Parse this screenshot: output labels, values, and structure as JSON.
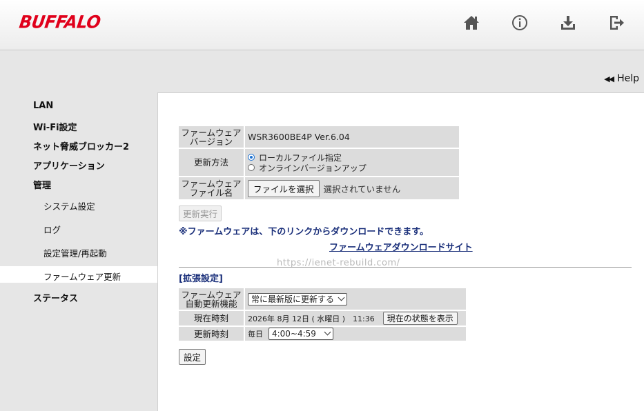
{
  "header": {
    "logo": "BUFFALO",
    "icons": [
      "home-icon",
      "info-icon",
      "download-icon",
      "logout-icon"
    ]
  },
  "help": {
    "label": "Help"
  },
  "sidebar": {
    "items": [
      {
        "label": "LAN"
      },
      {
        "label": "Wi-Fi設定"
      },
      {
        "label": "ネット脅威ブロッカー2"
      },
      {
        "label": "アプリケーション"
      },
      {
        "label": "管理"
      }
    ],
    "subitems": [
      {
        "label": "システム設定"
      },
      {
        "label": "ログ"
      },
      {
        "label": "設定管理/再起動"
      },
      {
        "label": "ファームウェア更新"
      }
    ],
    "status": "ステータス"
  },
  "firmware": {
    "version_label_1": "ファームウェア",
    "version_label_2": "バージョン",
    "version_value": "WSR3600BE4P Ver.6.04",
    "method_label": "更新方法",
    "method_options": [
      "ローカルファイル指定",
      "オンラインバージョンアップ"
    ],
    "file_label_1": "ファームウェア",
    "file_label_2": "ファイル名",
    "file_button": "ファイルを選択",
    "file_status": "選択されていません",
    "execute_button": "更新実行",
    "note": "※ファームウェアは、下のリンクからダウンロードできます。",
    "download_link": "ファームウェアダウンロードサイト",
    "watermark": "https://ienet-rebuild.com/"
  },
  "extended": {
    "title": "[拡張設定]",
    "auto_label_1": "ファームウェア",
    "auto_label_2": "自動更新機能",
    "auto_value": "常に最新版に更新する",
    "time_label": "現在時刻",
    "time_value": "2026年 8月 12日 ( 水曜日 )　11:36",
    "status_button": "現在の状態を表示",
    "update_label": "更新時刻",
    "update_prefix": "毎日",
    "update_value": "4:00~4:59",
    "save_button": "設定"
  },
  "colors": {
    "brand": "#e0001b",
    "link": "#1a2f7a",
    "radio_accent": "#1a6fd0"
  }
}
